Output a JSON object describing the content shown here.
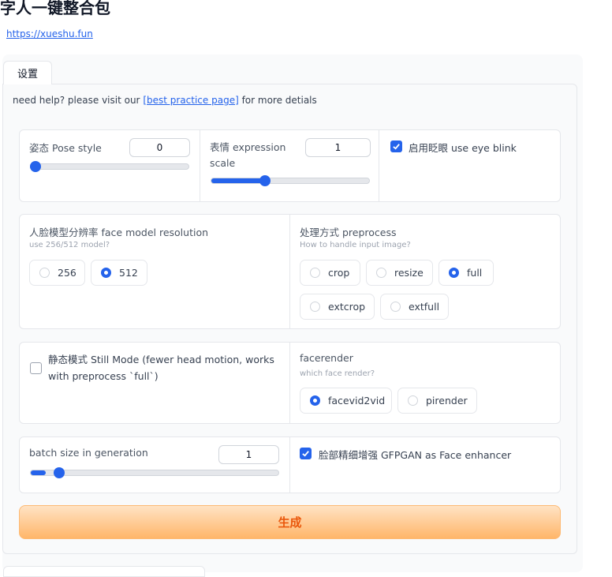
{
  "header": {
    "title": "字人一键整合包",
    "link": "https://xueshu.fun"
  },
  "tabs": [
    {
      "label": "设置"
    }
  ],
  "help": {
    "prefix": "need help? please visit our ",
    "link": "[best practice page]",
    "suffix": " for more detials"
  },
  "pose": {
    "label": "姿态 Pose style",
    "value": "0",
    "slider_fraction": 0.0
  },
  "expression": {
    "label": "表情 expression scale",
    "value": "1",
    "slider_fraction": 0.33
  },
  "eye_blink": {
    "label": "启用眨眼 use eye blink",
    "checked": true
  },
  "face_model": {
    "label": "人脸模型分辨率 face model resolution",
    "info": "use 256/512 model?",
    "options": [
      "256",
      "512"
    ],
    "selected": "512"
  },
  "preprocess": {
    "label": "处理方式 preprocess",
    "info": "How to handle input image?",
    "options": [
      "crop",
      "resize",
      "full",
      "extcrop",
      "extfull"
    ],
    "selected": "full"
  },
  "still_mode": {
    "label": "静态模式 Still Mode (fewer head motion, works with preprocess `full`)",
    "checked": false
  },
  "facerender": {
    "label": "facerender",
    "info": "which face render?",
    "options": [
      "facevid2vid",
      "pirender"
    ],
    "selected": "facevid2vid"
  },
  "batch": {
    "label": "batch size in generation",
    "value": "1",
    "slider_fraction": 0.0
  },
  "enhancer": {
    "label": "脸部精细增强 GFPGAN as Face enhancer",
    "checked": true
  },
  "generate": {
    "label": "生成"
  },
  "colors": {
    "accent": "#2563eb",
    "generate_text": "#ea580c",
    "generate_bg_top": "#ffe3c4",
    "generate_bg_bottom": "#ffb66a"
  }
}
